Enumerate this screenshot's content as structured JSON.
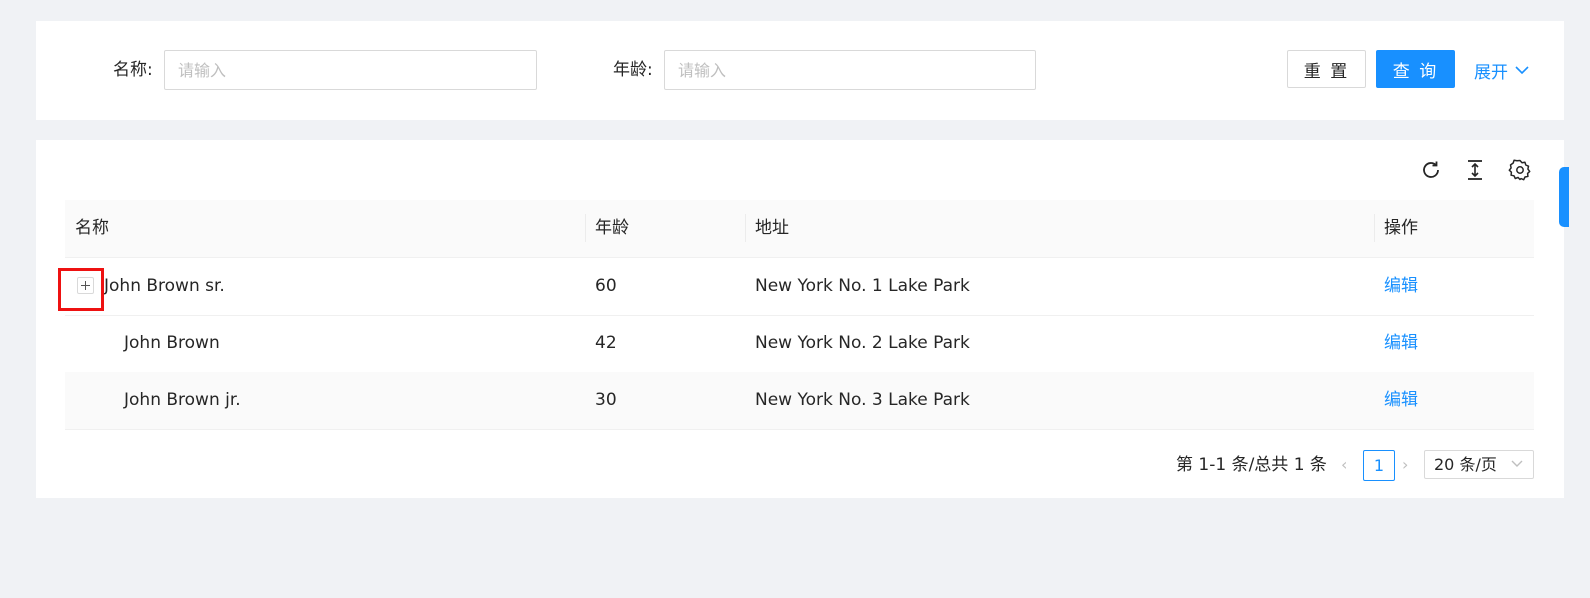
{
  "search": {
    "name_label": "名称:",
    "name_placeholder": "请输入",
    "age_label": "年龄:",
    "age_placeholder": "请输入",
    "reset_label": "重 置",
    "query_label": "查 询",
    "expand_label": "展开"
  },
  "toolbar": {
    "icons": [
      "reload-icon",
      "column-height-icon",
      "setting-icon"
    ]
  },
  "table": {
    "columns": [
      "名称",
      "年龄",
      "地址",
      "操作"
    ],
    "rows": [
      {
        "name": "John Brown sr.",
        "age": "60",
        "address": "New York No. 1 Lake Park",
        "action": "编辑"
      },
      {
        "name": "John Brown",
        "age": "42",
        "address": "New York No. 2 Lake Park",
        "action": "编辑"
      },
      {
        "name": "John Brown jr.",
        "age": "30",
        "address": "New York No. 3 Lake Park",
        "action": "编辑"
      }
    ]
  },
  "pagination": {
    "total_text": "第 1-1 条/总共 1 条",
    "current_page": "1",
    "page_size": "20 条/页"
  },
  "colors": {
    "primary": "#1890ff",
    "highlight": "#ee1111",
    "background": "#f0f2f5"
  }
}
